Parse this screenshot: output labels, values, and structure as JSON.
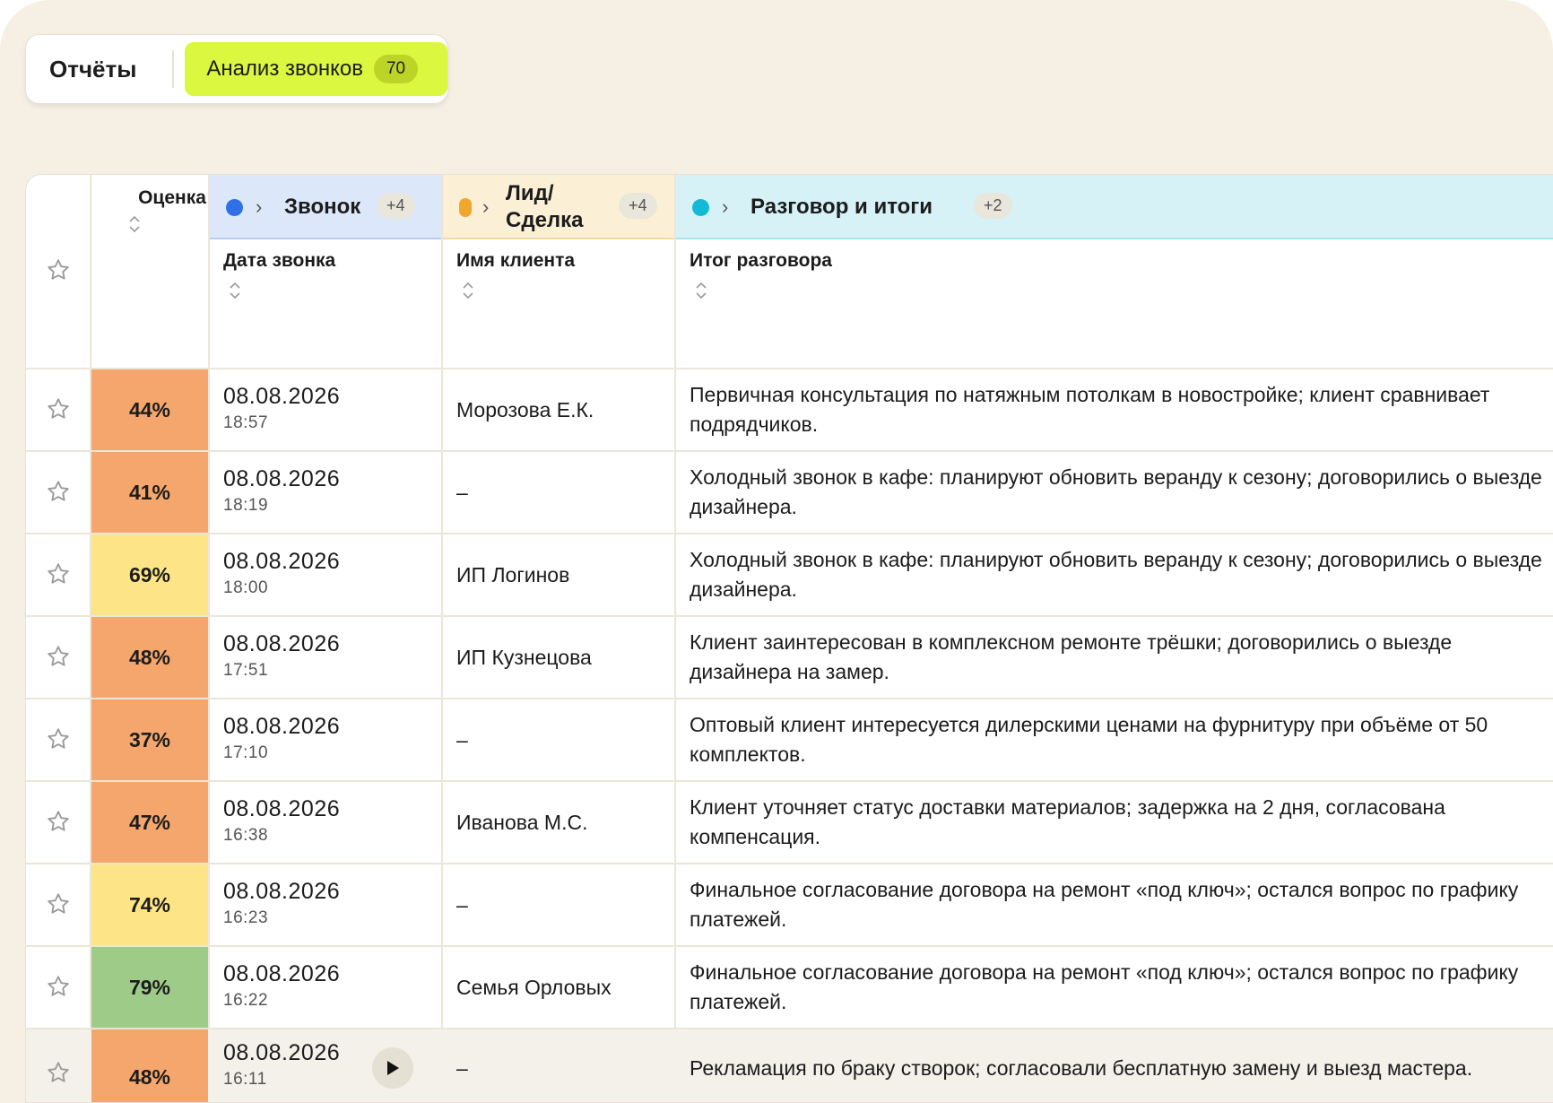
{
  "tabs": {
    "reports_label": "Отчёты",
    "active_label": "Анализ звонков",
    "active_count": "70"
  },
  "colors": {
    "accent_tab": "#dbf73f",
    "group_call": "#2f6fe8",
    "group_lead": "#f0a72b",
    "group_talk": "#14b9d6",
    "score_low": "#f4a66c",
    "score_mid": "#fde587",
    "score_high": "#9fcb89"
  },
  "table": {
    "score_header": "Оценка",
    "groups": [
      {
        "title": "Звонок",
        "more": "+4"
      },
      {
        "title_line1": "Лид/",
        "title_line2": "Сделка",
        "more": "+4"
      },
      {
        "title": "Разговор и итоги",
        "more": "+2"
      }
    ],
    "columns": {
      "date": "Дата звонка",
      "client": "Имя клиента",
      "summary": "Итог разговора"
    },
    "rows": [
      {
        "score": "44%",
        "level": 0.44,
        "date": "08.08.2026",
        "time": "18:57",
        "client": "Морозова Е.К.",
        "summary": "Первичная консультация по натяжным потолкам в новостройке; клиент сравнивает подрядчиков."
      },
      {
        "score": "41%",
        "level": 0.41,
        "date": "08.08.2026",
        "time": "18:19",
        "client": "–",
        "summary": "Холодный звонок в кафе: планируют обновить веранду к сезону; договорились о выезде дизайнера."
      },
      {
        "score": "69%",
        "level": 0.69,
        "date": "08.08.2026",
        "time": "18:00",
        "client": "ИП Логинов",
        "summary": "Холодный звонок в кафе: планируют обновить веранду к сезону; договорились о выезде дизайнера."
      },
      {
        "score": "48%",
        "level": 0.48,
        "date": "08.08.2026",
        "time": "17:51",
        "client": "ИП Кузнецова",
        "summary": "Клиент заинтересован в комплексном ремонте трёшки; договорились о выезде дизайнера на замер."
      },
      {
        "score": "37%",
        "level": 0.37,
        "date": "08.08.2026",
        "time": "17:10",
        "client": "–",
        "summary": "Оптовый клиент интересуется дилерскими ценами на фурнитуру при объёме от 50 комплектов."
      },
      {
        "score": "47%",
        "level": 0.47,
        "date": "08.08.2026",
        "time": "16:38",
        "client": "Иванова М.С.",
        "summary": "Клиент уточняет статус доставки материалов; задержка на 2 дня, согласована компенсация."
      },
      {
        "score": "74%",
        "level": 0.74,
        "date": "08.08.2026",
        "time": "16:23",
        "client": "–",
        "summary": "Финальное согласование договора на ремонт «под ключ»; остался вопрос по графику платежей."
      },
      {
        "score": "79%",
        "level": 0.79,
        "date": "08.08.2026",
        "time": "16:22",
        "client": "Семья Орловых",
        "summary": "Финальное согласование договора на ремонт «под ключ»; остался вопрос по графику платежей."
      },
      {
        "score": "48%",
        "level": 0.48,
        "date": "08.08.2026",
        "time": "16:11",
        "client": "–",
        "summary": "Рекламация по браку створок; согласовали бесплатную замену и выезд мастера."
      }
    ]
  }
}
